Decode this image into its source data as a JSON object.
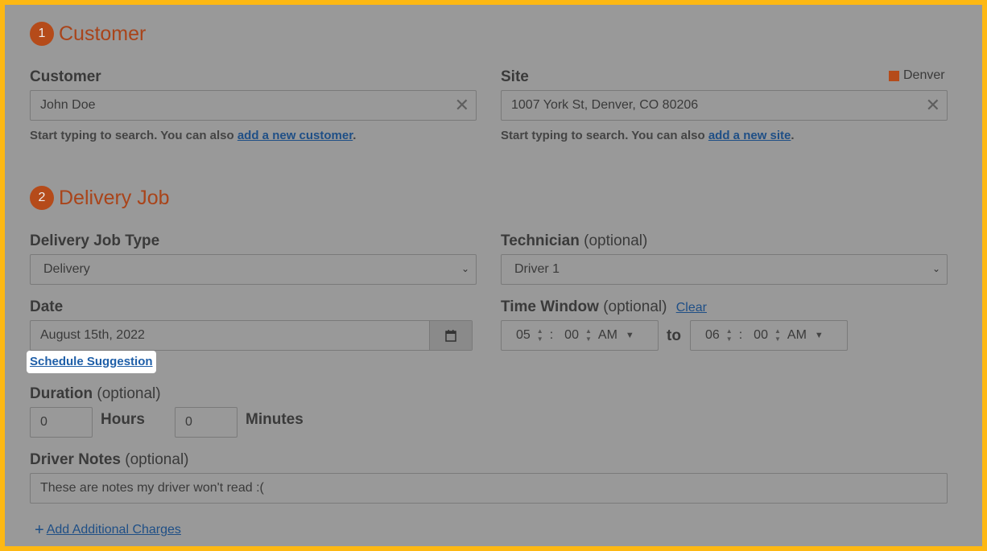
{
  "customer_section": {
    "number": "1",
    "title": "Customer",
    "customer": {
      "label": "Customer",
      "value": "John Doe",
      "help_prefix": "Start typing to search. You can also ",
      "help_link": "add a new customer",
      "help_suffix": "."
    },
    "site": {
      "label": "Site",
      "region_badge": "Denver",
      "region_color": "#b54b1a",
      "value": "1007 York St, Denver, CO 80206",
      "help_prefix": "Start typing to search. You can also ",
      "help_link": "add a new site",
      "help_suffix": "."
    }
  },
  "job_section": {
    "number": "2",
    "title": "Delivery Job",
    "job_type": {
      "label": "Delivery Job Type",
      "value": "Delivery"
    },
    "technician": {
      "label": "Technician",
      "optional": "(optional)",
      "value": "Driver 1"
    },
    "date": {
      "label": "Date",
      "value": "August 15th, 2022",
      "suggestion_link": "Schedule Suggestion"
    },
    "time_window": {
      "label": "Time Window",
      "optional": "(optional)",
      "clear": "Clear",
      "start": {
        "hour": "05",
        "minute": "00",
        "ampm": "AM"
      },
      "separator": "to",
      "end": {
        "hour": "06",
        "minute": "00",
        "ampm": "AM"
      },
      "colon": ":"
    },
    "duration": {
      "label": "Duration",
      "optional": "(optional)",
      "hours_value": "0",
      "hours_label": "Hours",
      "minutes_value": "0",
      "minutes_label": "Minutes"
    },
    "driver_notes": {
      "label": "Driver Notes",
      "optional": "(optional)",
      "value": "These are notes my driver won't read :("
    },
    "add_charges": "Add Additional Charges"
  },
  "colors": {
    "frame_border": "#fdb813",
    "accent": "#b54b1a",
    "link": "#1f4f86"
  }
}
